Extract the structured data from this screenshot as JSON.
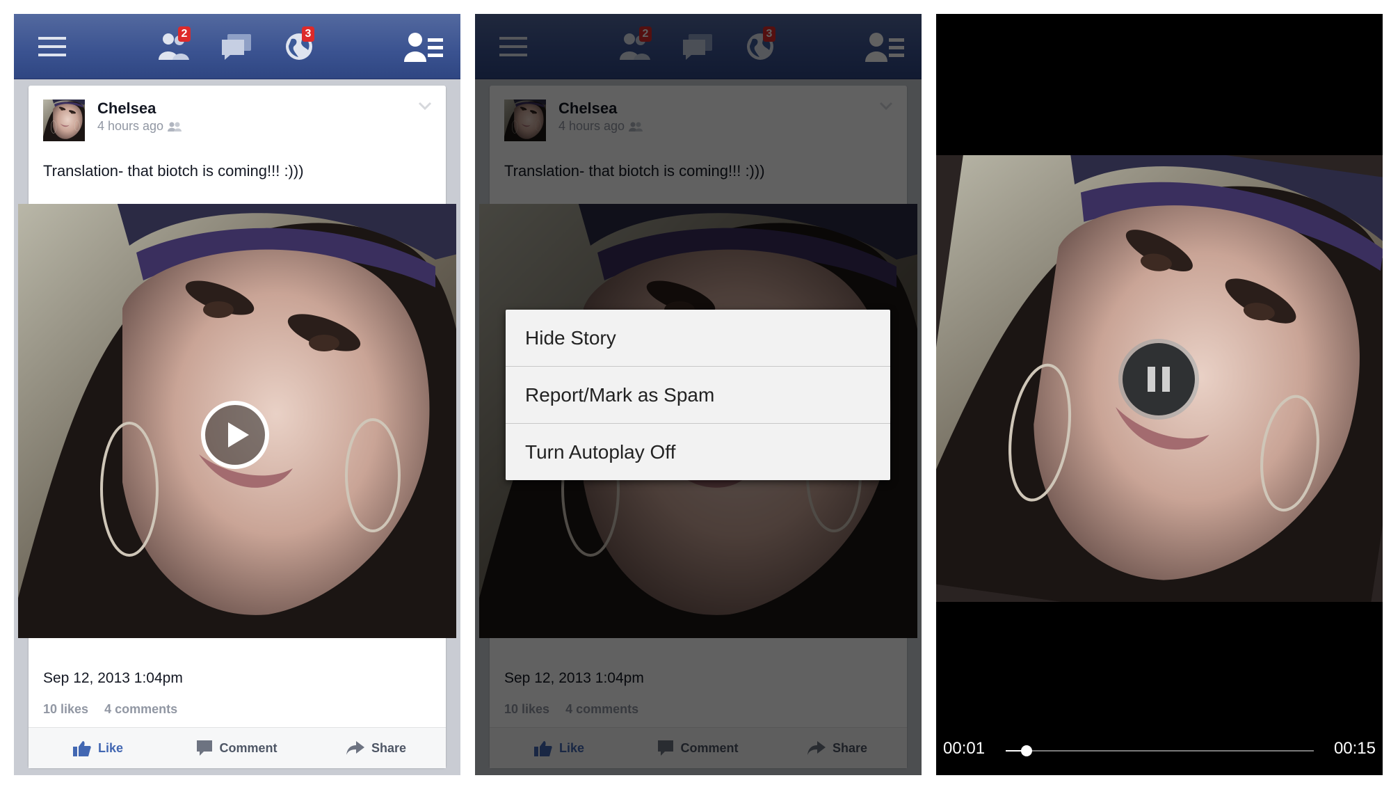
{
  "feed": {
    "badges": {
      "friend_requests": "2",
      "notifications": "3"
    },
    "post": {
      "author": "Chelsea",
      "time": "4 hours ago",
      "text": "Translation- that biotch is coming!!! :)))",
      "date": "Sep 12, 2013 1:04pm",
      "likes": "10 likes",
      "comments": "4 comments"
    },
    "actions": {
      "like": "Like",
      "comment": "Comment",
      "share": "Share"
    }
  },
  "context_menu": {
    "items": [
      "Hide Story",
      "Report/Mark as Spam",
      "Turn Autoplay Off"
    ]
  },
  "video_player": {
    "current_time": "00:01",
    "duration": "00:15",
    "progress": 0.067
  },
  "colors": {
    "navbar": "#3b5998",
    "badge": "#dd2a2a",
    "like": "#4267b2"
  }
}
